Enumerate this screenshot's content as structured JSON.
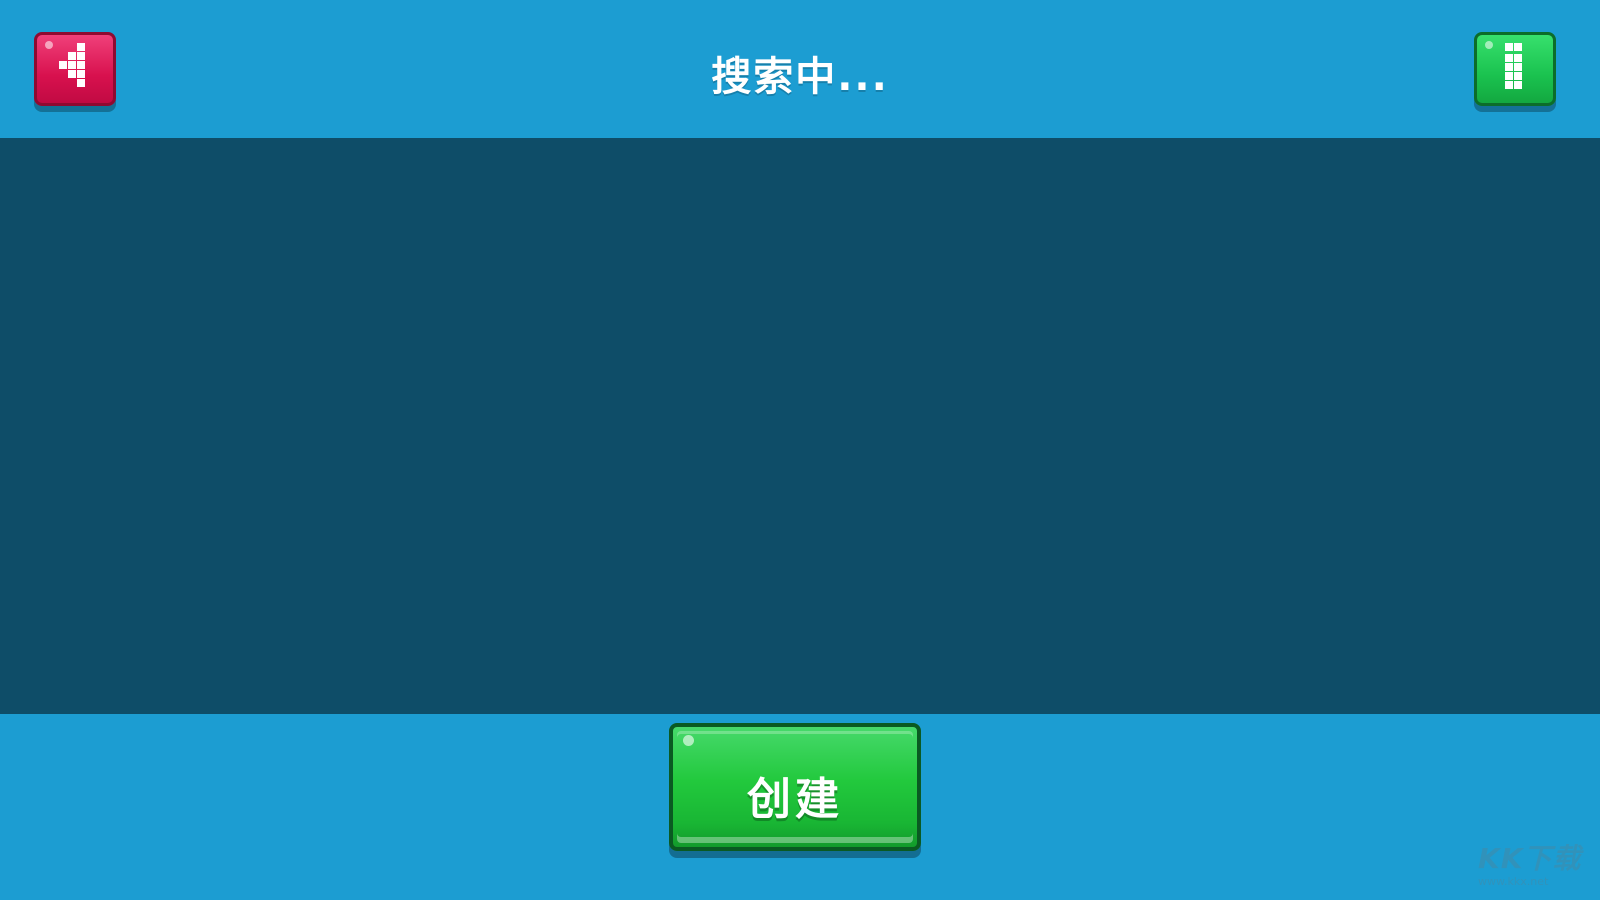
{
  "header": {
    "title": "搜索中..."
  },
  "buttons": {
    "back": {
      "icon": "back-arrow-icon",
      "color": "#d8114e"
    },
    "info": {
      "icon": "info-icon",
      "color": "#1ac24f"
    },
    "create": {
      "label": "创建",
      "color": "#22c93d"
    }
  },
  "watermark": {
    "logo": "KK下载",
    "url": "www.kkx.net"
  },
  "colors": {
    "bar": "#1c9dd2",
    "content": "#0e4d68"
  }
}
